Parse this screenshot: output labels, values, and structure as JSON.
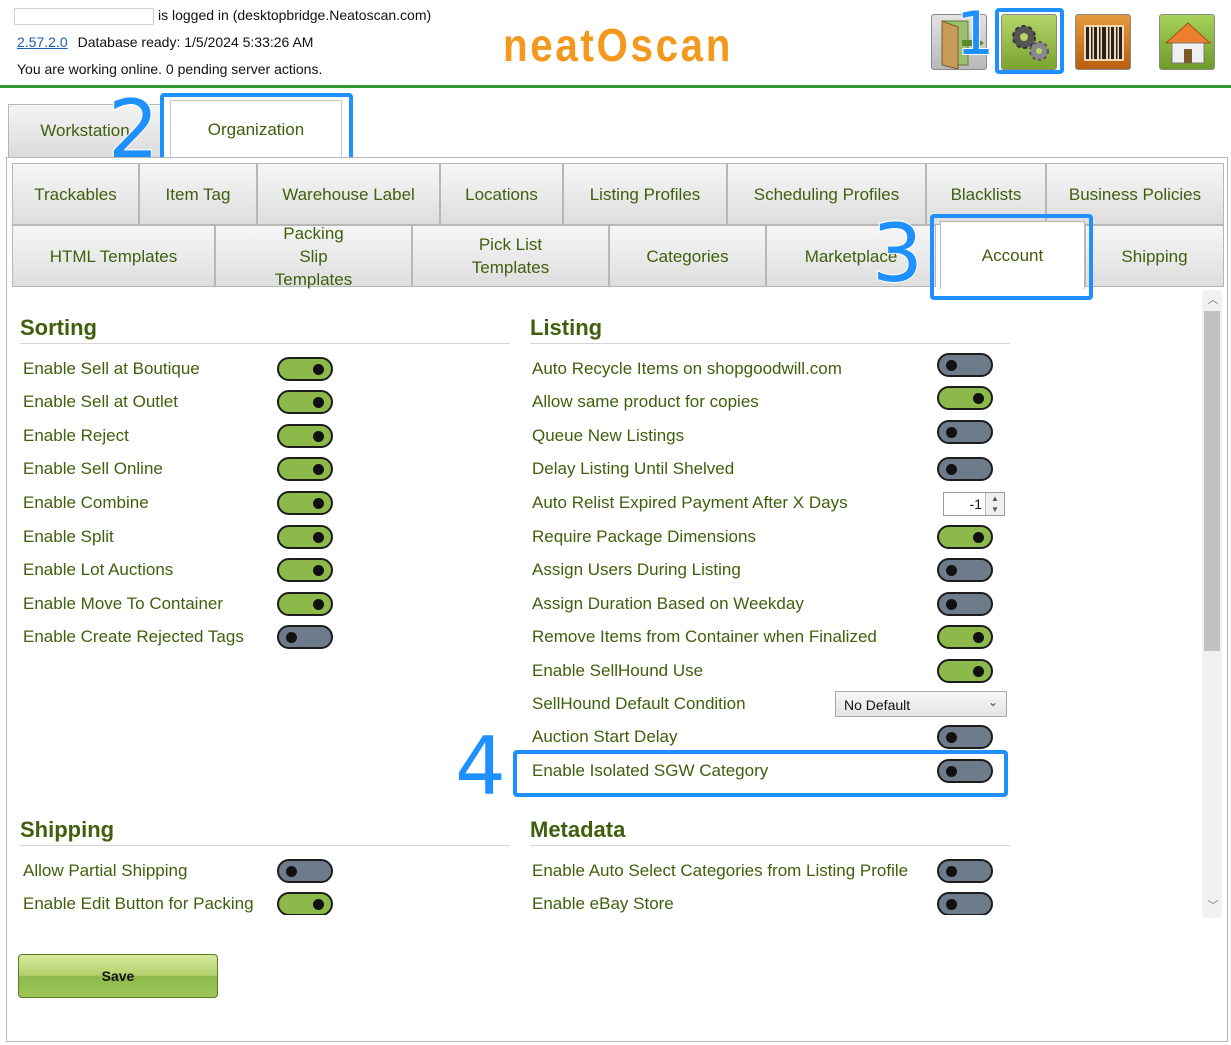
{
  "header": {
    "logged_in_text": "is logged in  (desktopbridge.Neatoscan.com)",
    "version": "2.57.2.0",
    "db_status": "Database ready: 1/5/2024 5:33:26 AM",
    "online_status": "You are working online.  0 pending server actions.",
    "logo_text": "neatOscan",
    "icons": [
      "exit-door-icon",
      "settings-gears-icon",
      "barcode-icon",
      "home-icon"
    ]
  },
  "top_tabs": [
    {
      "label": "Workstation"
    },
    {
      "label": "Organization",
      "active": true
    }
  ],
  "sub_tabs_row1": [
    "Trackables",
    "Item Tag",
    "Warehouse Label",
    "Locations",
    "Listing Profiles",
    "Scheduling Profiles",
    "Blacklists",
    "Business Policies"
  ],
  "sub_tabs_row2": [
    "HTML Templates",
    "Packing Slip Templates",
    "Pick List Templates",
    "Categories",
    "Marketplace",
    "Account",
    "Shipping"
  ],
  "sub_tab_active": "Account",
  "annotations": [
    "1",
    "2",
    "3",
    "4"
  ],
  "sorting": {
    "title": "Sorting",
    "items": [
      {
        "label": "Enable Sell at Boutique",
        "on": true
      },
      {
        "label": "Enable Sell at Outlet",
        "on": true
      },
      {
        "label": "Enable Reject",
        "on": true
      },
      {
        "label": "Enable Sell Online",
        "on": true
      },
      {
        "label": "Enable Combine",
        "on": true
      },
      {
        "label": "Enable Split",
        "on": true
      },
      {
        "label": "Enable Lot Auctions",
        "on": true
      },
      {
        "label": "Enable Move To Container",
        "on": true
      },
      {
        "label": "Enable Create Rejected Tags",
        "on": false
      }
    ]
  },
  "listing": {
    "title": "Listing",
    "items": [
      {
        "label": "Auto Recycle Items on shopgoodwill.com",
        "on": false
      },
      {
        "label": "Allow same product for copies",
        "on": true
      },
      {
        "label": "Queue New Listings",
        "on": false
      },
      {
        "label": "Delay Listing Until Shelved",
        "on": false
      },
      {
        "label": "Auto Relist Expired Payment After X Days",
        "value": "-1"
      },
      {
        "label": "Require Package Dimensions",
        "on": true
      },
      {
        "label": "Assign Users During Listing",
        "on": false
      },
      {
        "label": "Assign Duration Based on Weekday",
        "on": false
      },
      {
        "label": "Remove Items from Container when Finalized",
        "on": true
      },
      {
        "label": "Enable SellHound Use",
        "on": true
      },
      {
        "label": "SellHound Default Condition",
        "value": "No Default"
      },
      {
        "label": "Auction Start Delay",
        "on": false
      },
      {
        "label": "Enable Isolated SGW Category",
        "on": false
      }
    ]
  },
  "shipping": {
    "title": "Shipping",
    "items": [
      {
        "label": "Allow Partial Shipping",
        "on": false
      },
      {
        "label": "Enable Edit Button for Packing",
        "on": true
      }
    ]
  },
  "metadata": {
    "title": "Metadata",
    "items": [
      {
        "label": "Enable Auto Select Categories from Listing Profile",
        "on": false
      },
      {
        "label": "Enable eBay Store",
        "on": false
      }
    ]
  },
  "save_label": "Save",
  "colors": {
    "accent_green": "#8db84a",
    "label_green": "#3f5f0c",
    "toggle_off": "#6d7b8b",
    "highlight_blue": "#1e90ff",
    "logo_orange": "#f39a1e"
  }
}
